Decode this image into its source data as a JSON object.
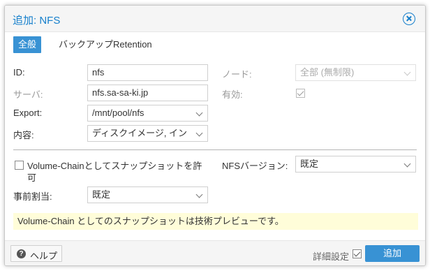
{
  "dialog": {
    "title": "追加: NFS"
  },
  "tabs": [
    {
      "label": "全般",
      "active": true
    },
    {
      "label": "バックアップRetention",
      "active": false
    }
  ],
  "fields": {
    "id": {
      "label": "ID:",
      "value": "nfs"
    },
    "server": {
      "label": "サーバ:",
      "value": "nfs.sa-sa-ki.jp"
    },
    "export": {
      "label": "Export:",
      "value": "/mnt/pool/nfs"
    },
    "content": {
      "label": "内容:",
      "value": "ディスクイメージ, イン"
    },
    "node": {
      "label": "ノード:",
      "value": "全部 (無制限)"
    },
    "enabled": {
      "label": "有効:",
      "checked": true
    },
    "volume_chain": {
      "label_line1": "Volume-Chainとしてスナップショットを許",
      "label_line2": "可",
      "checked": false
    },
    "preallocation": {
      "label": "事前割当:",
      "value": "既定"
    },
    "nfs_version": {
      "label": "NFSバージョン:",
      "value": "既定"
    }
  },
  "notice": {
    "text": "Volume-Chain としてのスナップショットは技術プレビューです。"
  },
  "footer": {
    "help_label": "ヘルプ",
    "advanced_label": "詳細設定",
    "advanced_checked": true,
    "add_label": "追加"
  },
  "colors": {
    "accent": "#157fcc",
    "primary_button": "#3892d4",
    "notice_background": "#fffdd9"
  }
}
